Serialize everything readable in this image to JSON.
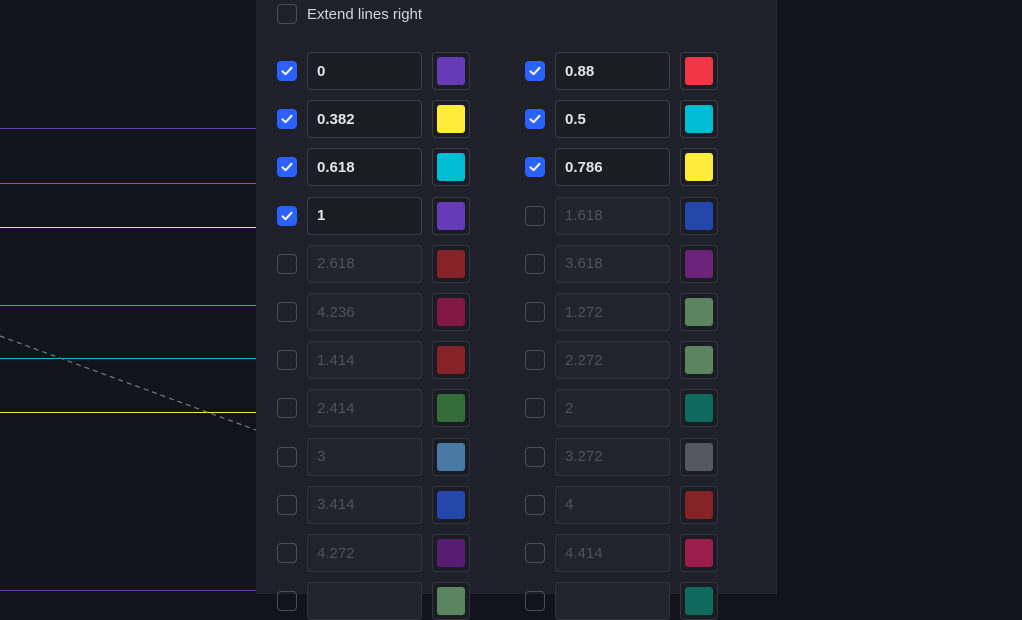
{
  "settings": {
    "extend_lines_right": {
      "label": "Extend lines right",
      "checked": false
    }
  },
  "levels": {
    "left": [
      {
        "value": "0",
        "enabled": true,
        "color": "#673ab7"
      },
      {
        "value": "0.382",
        "enabled": true,
        "color": "#ffeb3b"
      },
      {
        "value": "0.618",
        "enabled": true,
        "color": "#00bcd4"
      },
      {
        "value": "1",
        "enabled": true,
        "color": "#673ab7"
      },
      {
        "value": "2.618",
        "enabled": false,
        "color": "#c62828"
      },
      {
        "value": "4.236",
        "enabled": false,
        "color": "#c2185b"
      },
      {
        "value": "1.414",
        "enabled": false,
        "color": "#c62828"
      },
      {
        "value": "2.414",
        "enabled": false,
        "color": "#43a047"
      },
      {
        "value": "3",
        "enabled": false,
        "color": "#64b5f6"
      },
      {
        "value": "3.414",
        "enabled": false,
        "color": "#2962ff"
      },
      {
        "value": "4.272",
        "enabled": false,
        "color": "#7b1fa2"
      },
      {
        "value": "",
        "enabled": false,
        "color": "#81c784"
      }
    ],
    "right": [
      {
        "value": "0.88",
        "enabled": true,
        "color": "#f23645"
      },
      {
        "value": "0.5",
        "enabled": true,
        "color": "#00bcd4"
      },
      {
        "value": "0.786",
        "enabled": true,
        "color": "#ffeb3b"
      },
      {
        "value": "1.618",
        "enabled": false,
        "color": "#2962ff"
      },
      {
        "value": "3.618",
        "enabled": false,
        "color": "#9c27b0"
      },
      {
        "value": "1.272",
        "enabled": false,
        "color": "#81c784"
      },
      {
        "value": "2.272",
        "enabled": false,
        "color": "#81c784"
      },
      {
        "value": "2",
        "enabled": false,
        "color": "#089981"
      },
      {
        "value": "3.272",
        "enabled": false,
        "color": "#787b86"
      },
      {
        "value": "4",
        "enabled": false,
        "color": "#c62828"
      },
      {
        "value": "4.414",
        "enabled": false,
        "color": "#e91e63"
      },
      {
        "value": "",
        "enabled": false,
        "color": "#089981"
      }
    ]
  },
  "chart_lines": [
    {
      "color": "#673ab7"
    },
    {
      "color": "#f23645"
    },
    {
      "color": "#ffeb3b"
    },
    {
      "color": "#00bcd4"
    },
    {
      "color": "#00bcd4"
    },
    {
      "color": "#ffeb3b"
    },
    {
      "color": "#673ab7"
    }
  ],
  "trend_line_color": "#787b86"
}
